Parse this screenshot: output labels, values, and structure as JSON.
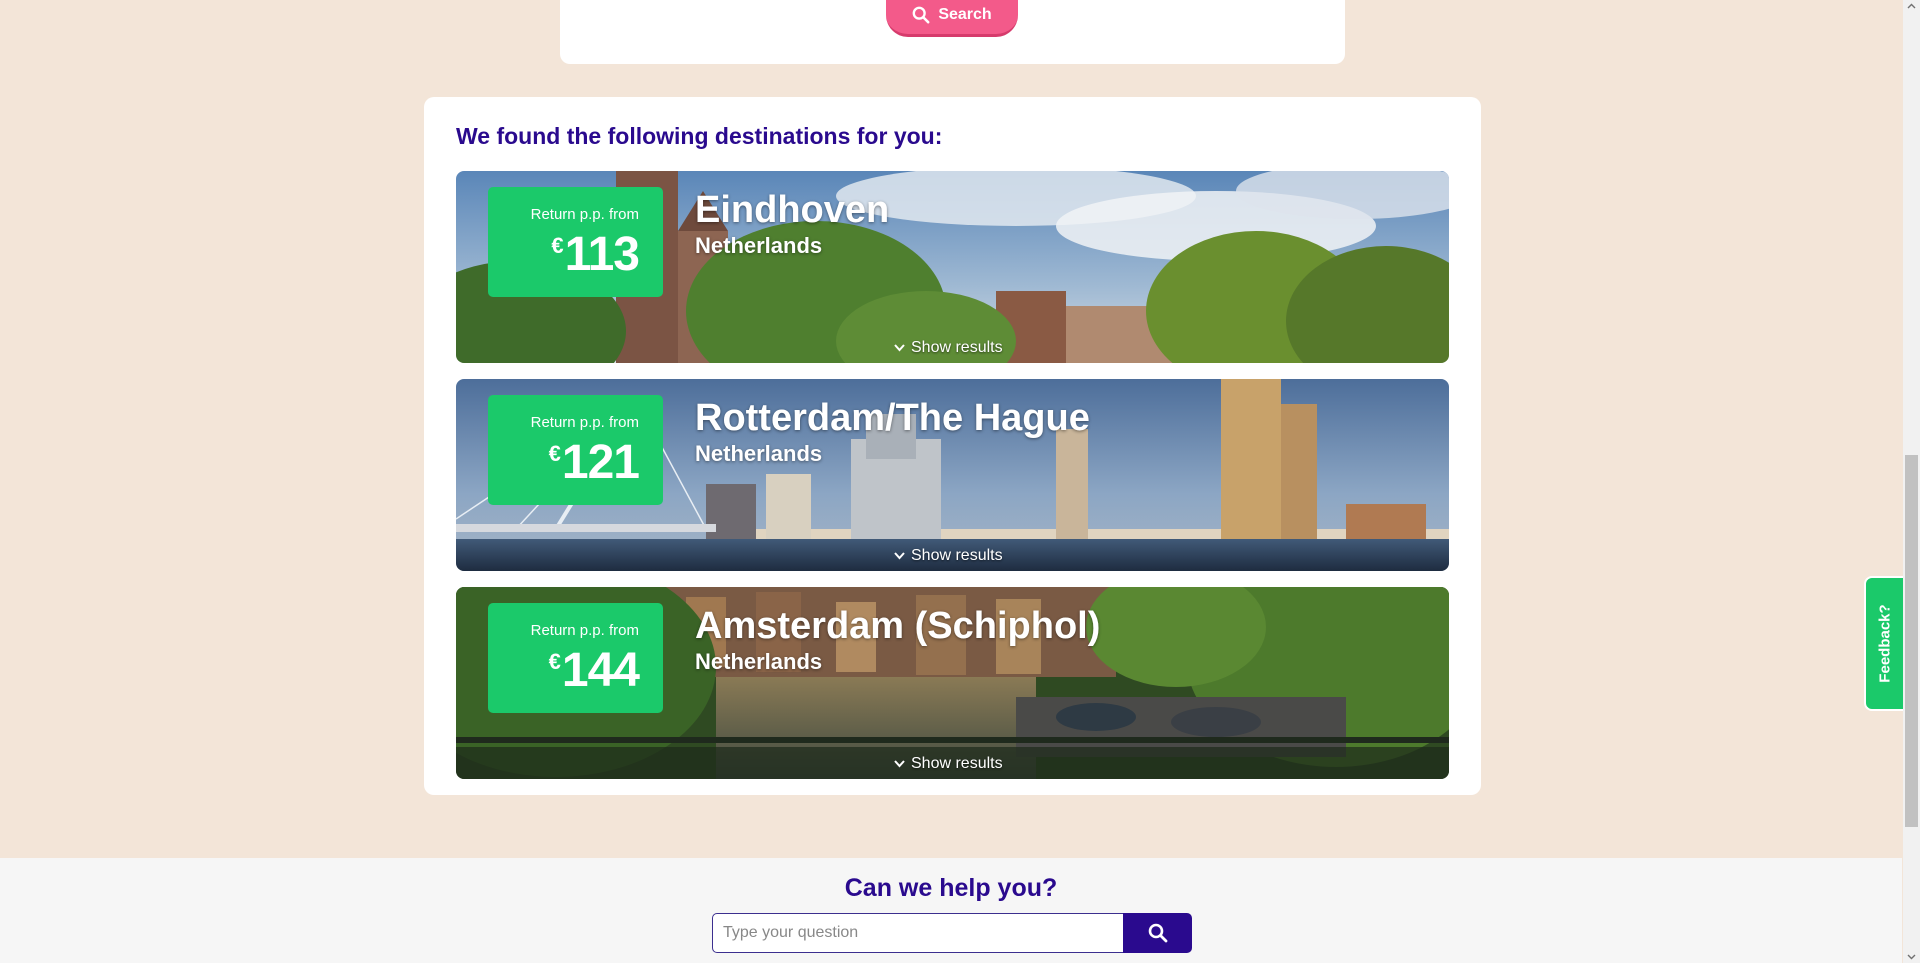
{
  "search": {
    "button_label": "Search"
  },
  "results": {
    "heading": "We found the following destinations for you:",
    "destinations": [
      {
        "price_label": "Return p.p. from",
        "currency": "€",
        "price": "113",
        "city": "Eindhoven",
        "country": "Netherlands",
        "show_results": "Show results"
      },
      {
        "price_label": "Return p.p. from",
        "currency": "€",
        "price": "121",
        "city": "Rotterdam/The Hague",
        "country": "Netherlands",
        "show_results": "Show results"
      },
      {
        "price_label": "Return p.p. from",
        "currency": "€",
        "price": "144",
        "city": "Amsterdam (Schiphol)",
        "country": "Netherlands",
        "show_results": "Show results"
      }
    ]
  },
  "help": {
    "title": "Can we help you?",
    "input_placeholder": "Type your question"
  },
  "feedback": {
    "label": "Feedback?"
  },
  "colors": {
    "page_background": "#f3e5d8",
    "brand_purple": "#2a0a8e",
    "price_green": "#1bc96a",
    "search_pink": "#f35a8a"
  }
}
